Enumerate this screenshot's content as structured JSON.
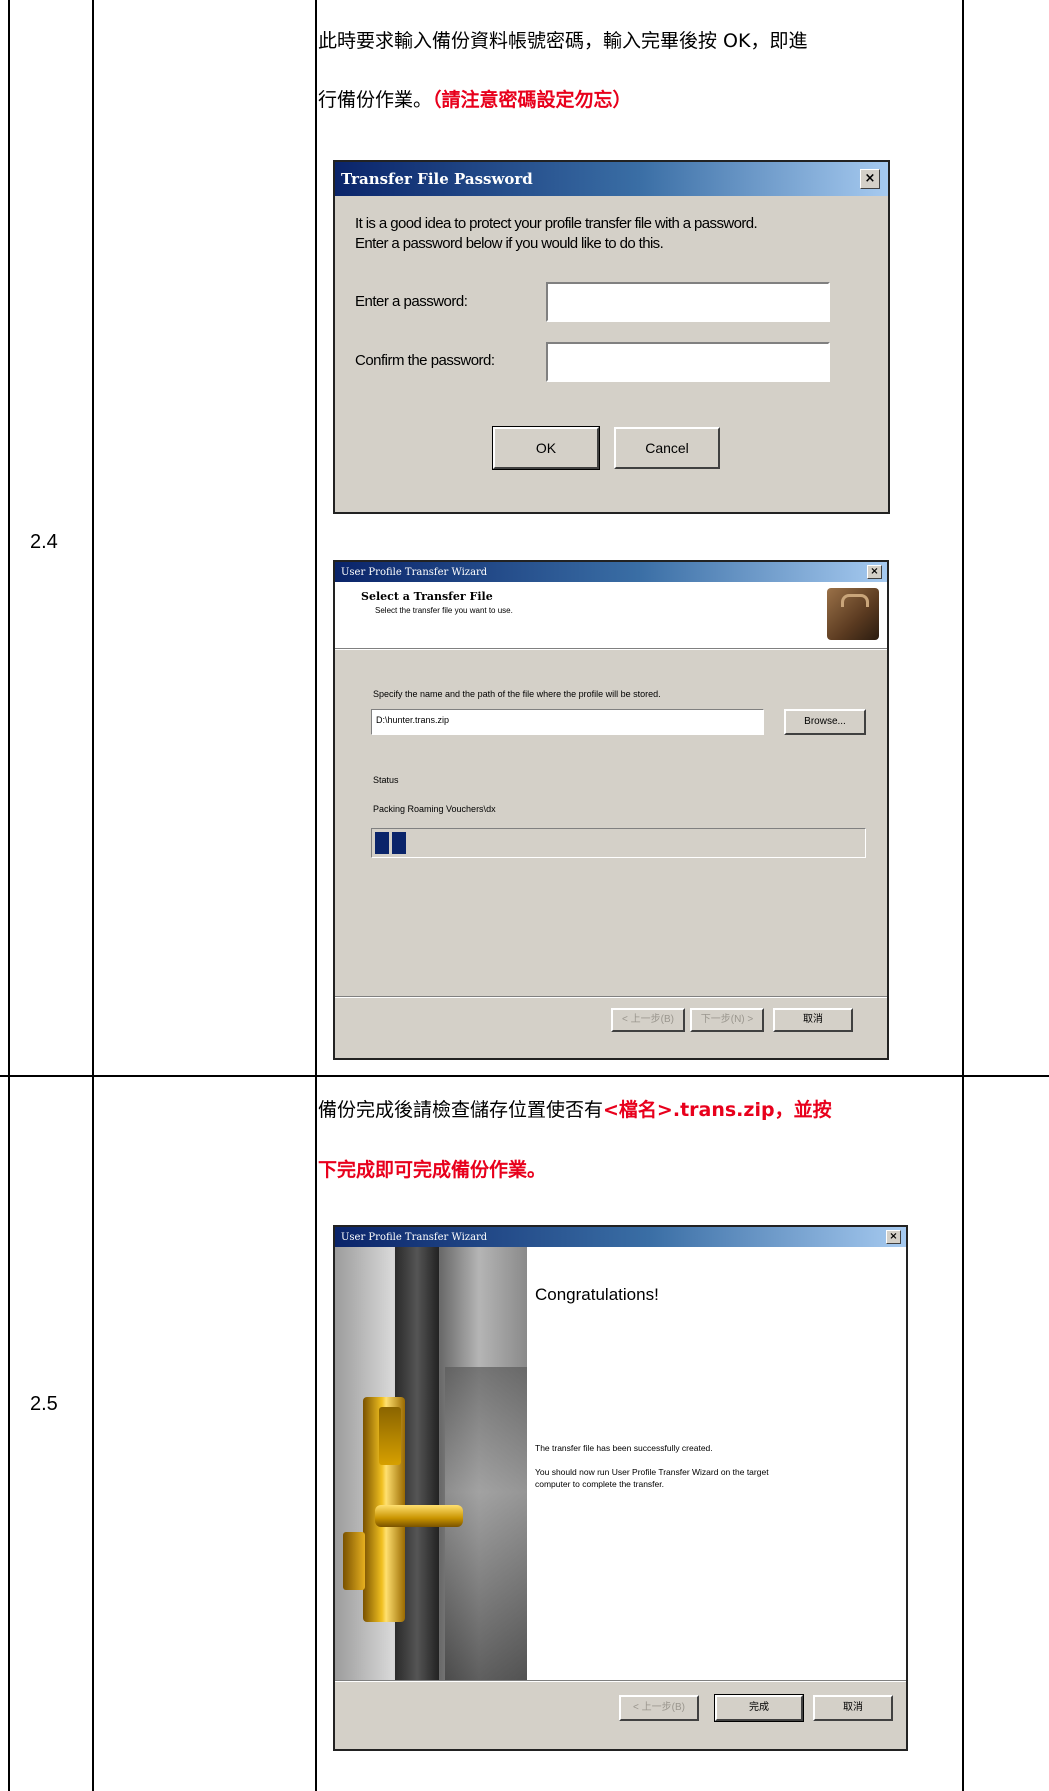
{
  "rows": [
    {
      "step": "2.4"
    },
    {
      "step": "2.5"
    }
  ],
  "row24": {
    "instr_line1": "此時要求輸入備份資料帳號密碼，輸入完畢後按 OK，即進",
    "instr_line2_black": "行備份作業。",
    "instr_line2_red": "（請注意密碼設定勿忘）",
    "password_dialog": {
      "title": "Transfer File Password",
      "desc_line1": "It is a good idea to protect your profile transfer file with a password.",
      "desc_line2": "Enter a password below if you would like to do this.",
      "label_enter": "Enter a password:",
      "label_confirm": "Confirm the password:",
      "ok": "OK",
      "cancel": "Cancel",
      "close": "×"
    },
    "wizard": {
      "title": "User Profile Transfer Wizard",
      "heading": "Select a Transfer File",
      "subheading": "Select the transfer file you want to use.",
      "instruction": "Specify the name and the path of the file where the profile will be stored.",
      "path_value": "D:\\hunter.trans.zip",
      "browse": "Browse...",
      "status_label": "Status",
      "status_text": "Packing Roaming Vouchers\\dx",
      "progress": 0.07,
      "back": "< 上一步(B)",
      "next": "下一步(N) >",
      "cancel": "取消",
      "close": "×"
    }
  },
  "row25": {
    "instr_line1_black": "備份完成後請檢查儲存位置使否有",
    "instr_line1_red": "<檔名>.trans.zip，並按",
    "instr_line2_red": "下完成即可完成備份作業。",
    "wizard": {
      "title": "User Profile Transfer Wizard",
      "heading": "Congratulations!",
      "line1": "The transfer file has been successfully created.",
      "line2a": "You should now run User Profile Transfer Wizard on the target",
      "line2b": "computer to complete the transfer.",
      "back": "< 上一步(B)",
      "finish": "完成",
      "cancel": "取消",
      "close": "×"
    }
  }
}
